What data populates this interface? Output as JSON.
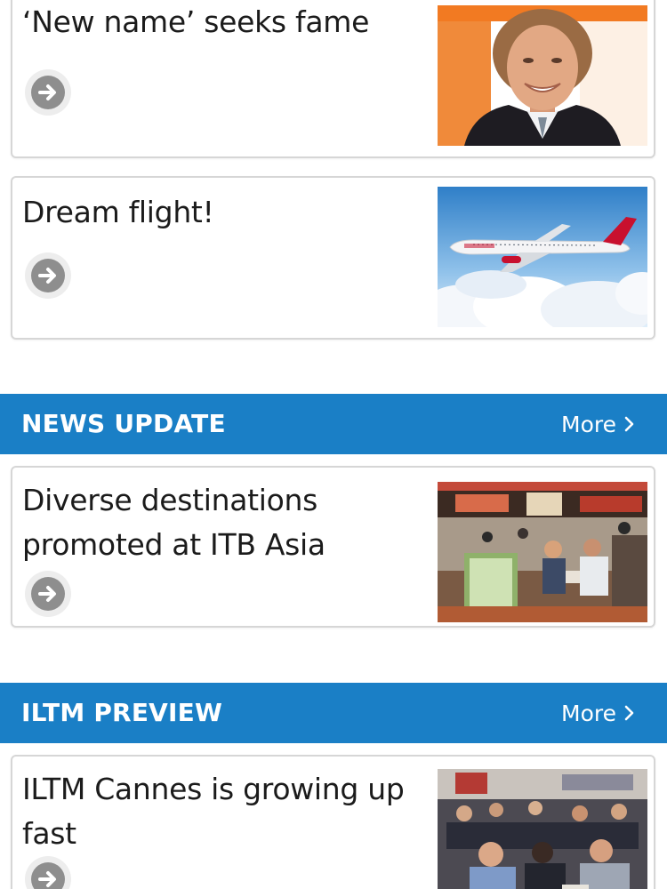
{
  "articles": [
    {
      "title": "‘New name’ seeks fame",
      "thumb_subject": "man in dark suit smiling in front of orange backdrop"
    },
    {
      "title": "Dream flight!",
      "thumb_subject": "Virgin aircraft flying above clouds"
    }
  ],
  "sections": [
    {
      "title": "NEWS UPDATE",
      "more_label": "More",
      "articles": [
        {
          "title": "Diverse destinations promoted at ITB Asia",
          "thumb_subject": "trade show booths with people seated at meeting tables"
        }
      ]
    },
    {
      "title": "ILTM PREVIEW",
      "more_label": "More",
      "articles": [
        {
          "title": "ILTM Cannes is growing up fast",
          "thumb_subject": "crowded exhibition hall with people in meetings"
        }
      ]
    }
  ],
  "icons": {
    "read_more": "arrow-right-circle-icon",
    "more": "chevron-right-icon"
  },
  "colors": {
    "section_bar": "#1a7fc6",
    "section_text": "#ffffff",
    "card_border": "#d6d6d6",
    "title_text": "#1b1b1b",
    "arrow_icon": "#8e8e8e"
  }
}
